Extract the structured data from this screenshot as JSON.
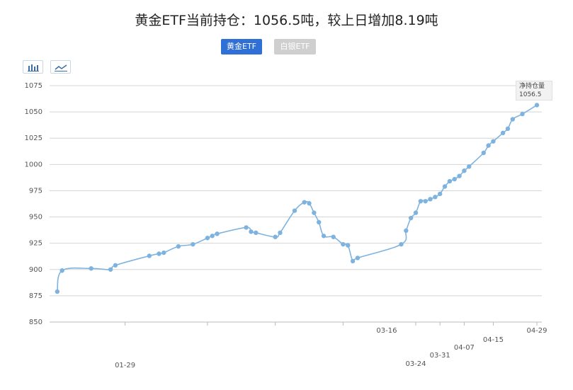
{
  "header": {
    "title": "黄金ETF当前持仓：1056.5吨，较上日增加8.19吨"
  },
  "tabs": [
    {
      "label": "黄金ETF",
      "active": true
    },
    {
      "label": "白银ETF",
      "active": false
    }
  ],
  "toolbar": {
    "bar_icon": "bar-chart-icon",
    "line_icon": "line-chart-icon"
  },
  "tooltip": {
    "label": "净持仓量",
    "value": "1056.5"
  },
  "colors": {
    "line": "#7fb3df",
    "accent": "#2f6fd6"
  },
  "chart_data": {
    "type": "line",
    "title": "黄金ETF当前持仓：1056.5吨，较上日增加8.19吨",
    "xlabel": "",
    "ylabel": "",
    "ylim": [
      850,
      1075
    ],
    "yticks": [
      1075,
      1050,
      1025,
      1000,
      975,
      950,
      925,
      900,
      875,
      850
    ],
    "grid": true,
    "x_tick_labels": [
      {
        "label": "01-29",
        "x": 15
      },
      {
        "label": "03-16",
        "x": 69
      },
      {
        "label": "03-24",
        "x": 75
      },
      {
        "label": "03-31",
        "x": 80
      },
      {
        "label": "04-07",
        "x": 85
      },
      {
        "label": "04-15",
        "x": 91
      },
      {
        "label": "04-29",
        "x": 100
      }
    ],
    "x_minor_ticks": [
      15,
      32,
      46,
      60,
      75,
      80,
      85,
      91,
      100
    ],
    "series": [
      {
        "x": [
          1,
          2,
          8,
          12,
          13,
          20,
          22,
          23,
          26,
          29,
          32,
          33,
          34,
          40,
          41,
          42,
          46,
          47,
          50,
          52,
          53,
          54,
          55,
          56,
          58,
          60,
          61,
          62,
          63,
          72,
          73,
          74,
          75,
          76,
          77,
          78,
          79,
          80,
          81,
          82,
          83,
          84,
          85,
          86,
          89,
          90,
          91,
          93,
          94,
          95,
          97,
          100
        ],
        "y": [
          879,
          899,
          901,
          900,
          904,
          913,
          915,
          916,
          922,
          924,
          930,
          932,
          934,
          940,
          936,
          935,
          931,
          935,
          956,
          964,
          963,
          954,
          945,
          932,
          931,
          924,
          923,
          908,
          911,
          924,
          937,
          949,
          954,
          965,
          965,
          967,
          969,
          972,
          979,
          984,
          986,
          989,
          994,
          998,
          1011,
          1018,
          1022,
          1030,
          1034,
          1043,
          1048,
          1056.5
        ]
      }
    ]
  }
}
